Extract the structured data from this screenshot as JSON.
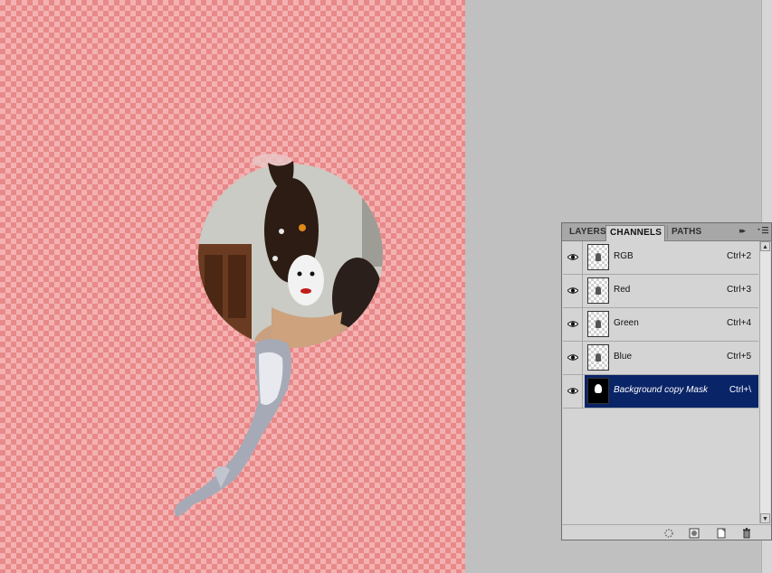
{
  "panel": {
    "tabs": [
      {
        "label": "LAYERS",
        "active": false
      },
      {
        "label": "CHANNELS",
        "active": true
      },
      {
        "label": "PATHS",
        "active": false
      }
    ],
    "channels": [
      {
        "name": "RGB",
        "shortcut": "Ctrl+2",
        "visible": true,
        "selected": false
      },
      {
        "name": "Red",
        "shortcut": "Ctrl+3",
        "visible": true,
        "selected": false
      },
      {
        "name": "Green",
        "shortcut": "Ctrl+4",
        "visible": true,
        "selected": false
      },
      {
        "name": "Blue",
        "shortcut": "Ctrl+5",
        "visible": true,
        "selected": false
      },
      {
        "name": "Background copy Mask",
        "shortcut": "Ctrl+\\",
        "visible": true,
        "selected": true
      }
    ],
    "footer_icons": [
      "load-selection-icon",
      "save-selection-icon",
      "new-channel-icon",
      "delete-channel-icon"
    ]
  },
  "colors": {
    "canvas_check_light": "#f4b1b1",
    "canvas_check_dark": "#e88989",
    "selection_blue": "#0a2468",
    "workspace_gray": "#c0c0c0"
  }
}
